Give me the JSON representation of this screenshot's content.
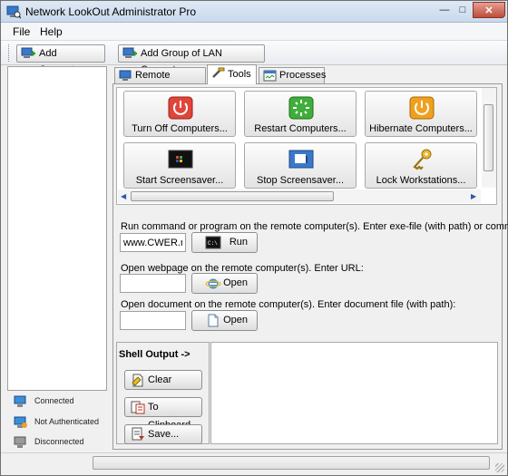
{
  "window": {
    "title": "Network LookOut Administrator Pro",
    "controls": [
      "minimize-icon",
      "maximize-icon",
      "close-icon"
    ]
  },
  "menu": {
    "file": "File",
    "help": "Help"
  },
  "toolbar": {
    "add_computer": "Add Computer",
    "add_group": "Add Group of LAN Computers"
  },
  "tabs": {
    "remote_screens": "Remote Screens",
    "tools": "Tools",
    "processes": "Processes",
    "selected": "Tools"
  },
  "tools": [
    {
      "label": "Turn Off Computers...",
      "icon": "power-icon"
    },
    {
      "label": "Restart Computers...",
      "icon": "restart-icon"
    },
    {
      "label": "Hibernate Computers...",
      "icon": "hibernate-icon"
    },
    {
      "label": "Start Screensaver...",
      "icon": "screensaver-start-icon"
    },
    {
      "label": "Stop Screensaver...",
      "icon": "screensaver-stop-icon"
    },
    {
      "label": "Lock Workstations...",
      "icon": "key-icon"
    }
  ],
  "command": {
    "run_label": "Run command or program on the remote computer(s). Enter exe-file (with path) or command:",
    "run_value": "www.CWER.ru",
    "run_button": "Run",
    "web_label": "Open webpage on the remote computer(s). Enter URL:",
    "web_value": "",
    "web_button": "Open",
    "doc_label": "Open document on the remote computer(s). Enter document file (with path):",
    "doc_value": "",
    "doc_button": "Open"
  },
  "shell": {
    "title": "Shell Output ->",
    "clear": "Clear",
    "clipboard": "To Clipboard",
    "save": "Save...",
    "output": ""
  },
  "legend": {
    "connected": "Connected",
    "not_authenticated": "Not Authenticated",
    "disconnected": "Disconnected"
  },
  "colors": {
    "power": "#e0453a",
    "restart": "#3fae3a",
    "hibernate": "#f0a020",
    "accent": "#2a5aa8"
  }
}
